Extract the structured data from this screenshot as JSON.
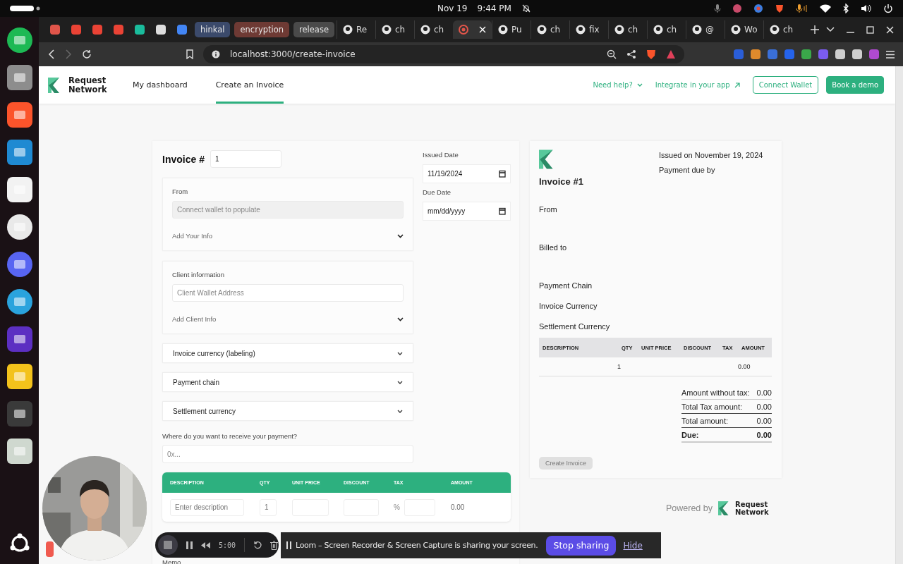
{
  "system_bar": {
    "date": "Nov 19",
    "time": "9:44 PM"
  },
  "browser": {
    "groups": [
      {
        "label": "hinkal",
        "color": "#3b4a6b"
      },
      {
        "label": "encryption",
        "color": "#6e3a34"
      },
      {
        "label": "release",
        "color": "#4a4a4a"
      }
    ],
    "tabs": [
      {
        "label": "Re",
        "selected": false
      },
      {
        "label": "ch",
        "selected": false
      },
      {
        "label": "ch",
        "selected": false
      },
      {
        "selected": true
      },
      {
        "label": "Pu",
        "selected": false
      },
      {
        "label": "ch",
        "selected": false
      },
      {
        "label": "fix",
        "selected": false
      },
      {
        "label": "ch",
        "selected": false
      },
      {
        "label": "ch",
        "selected": false
      },
      {
        "label": "@",
        "selected": false
      },
      {
        "label": "Wo",
        "selected": false
      },
      {
        "label": "ch",
        "selected": false
      }
    ],
    "url": "localhost:3000/create-invoice"
  },
  "nav": {
    "brand": "Request Network",
    "links": [
      {
        "label": "My dashboard",
        "selected": false
      },
      {
        "label": "Create an Invoice",
        "selected": true
      }
    ],
    "help": "Need help?",
    "integrate": "Integrate in your app",
    "connect": "Connect Wallet",
    "demo": "Book a demo"
  },
  "form": {
    "invoice_label": "Invoice #",
    "invoice_number": "1",
    "issued_label": "Issued Date",
    "issued_value": "11/19/2024",
    "due_label": "Due Date",
    "due_placeholder": "mm/dd/yyyy",
    "from": {
      "label": "From",
      "placeholder": "Connect wallet to populate",
      "expand": "Add Your Info"
    },
    "client": {
      "label": "Client information",
      "placeholder": "Client Wallet Address",
      "expand": "Add Client Info"
    },
    "selects": [
      "Invoice currency (labeling)",
      "Payment chain",
      "Settlement currency"
    ],
    "payment_label": "Where do you want to receive your payment?",
    "payment_placeholder": "0x...",
    "table": {
      "columns": [
        "DESCRIPTION",
        "QTY",
        "UNIT PRICE",
        "DISCOUNT",
        "TAX",
        "AMOUNT"
      ],
      "row": {
        "description_placeholder": "Enter description",
        "qty": "1",
        "tax_unit": "%",
        "amount": "0.00"
      }
    },
    "memo": "Memo"
  },
  "preview": {
    "issued": "Issued on November 19, 2024",
    "due": "Payment due by",
    "title": "Invoice #1",
    "sections": [
      "From",
      "Billed to",
      "Payment Chain",
      "Invoice Currency",
      "Settlement Currency"
    ],
    "columns": [
      "DESCRIPTION",
      "QTY",
      "UNIT PRICE",
      "DISCOUNT",
      "TAX",
      "AMOUNT"
    ],
    "row": {
      "qty": "1",
      "amount": "0.00"
    },
    "totals": [
      {
        "label": "Amount without tax:",
        "value": "0.00",
        "kind": "normal"
      },
      {
        "label": "Total Tax amount:",
        "value": "0.00",
        "kind": "normal"
      },
      {
        "label": "Total amount:",
        "value": "0.00",
        "kind": "normal"
      },
      {
        "label": "Due:",
        "value": "0.00",
        "kind": "due"
      }
    ],
    "create": {
      "label": "Create Invoice",
      "disabled": true
    },
    "powered": "Powered by",
    "brand": "Request Network"
  },
  "loom": {
    "timer": "5:00",
    "message": "Loom – Screen Recorder & Screen Capture is sharing your screen.",
    "stop": "Stop sharing",
    "hide": "Hide"
  }
}
